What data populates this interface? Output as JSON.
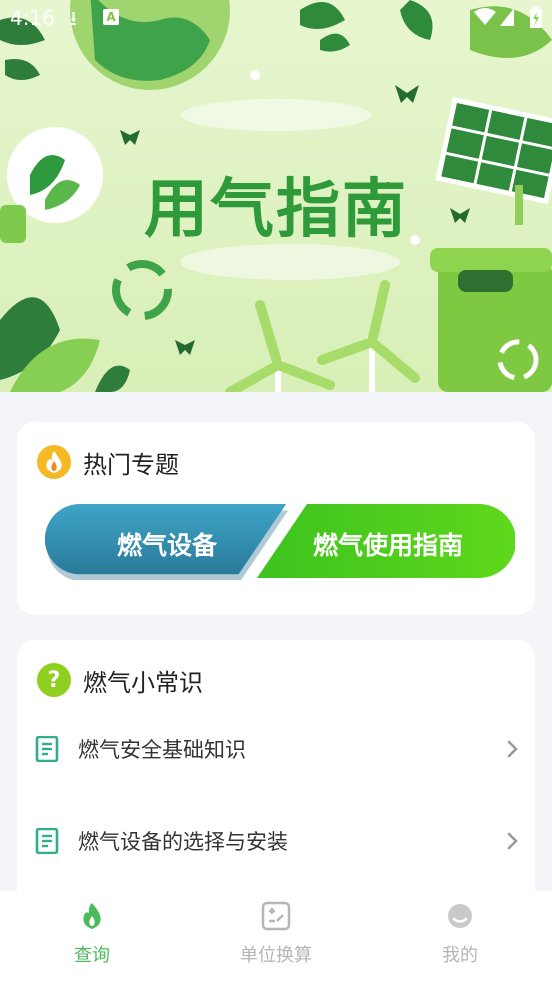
{
  "status_bar": {
    "time": "4:16"
  },
  "banner": {
    "title": "用气指南"
  },
  "hot_topics": {
    "title": "热门专题",
    "buttons": [
      "燃气设备",
      "燃气使用指南"
    ]
  },
  "tips": {
    "title": "燃气小常识",
    "items": [
      "燃气安全基础知识",
      "燃气设备的选择与安装"
    ]
  },
  "nav": {
    "items": [
      {
        "label": "查询",
        "icon": "flame-icon",
        "active": true
      },
      {
        "label": "单位换算",
        "icon": "calculator-icon",
        "active": false
      },
      {
        "label": "我的",
        "icon": "profile-icon",
        "active": false
      }
    ]
  },
  "colors": {
    "accent_green": "#4dbb5c",
    "banner_title": "#2e9a39",
    "device_button": "#2c7d9e",
    "guide_button": "#52d01e"
  }
}
